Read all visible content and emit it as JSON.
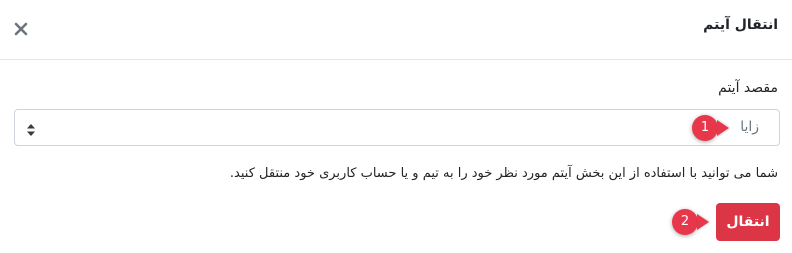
{
  "dialog": {
    "title": "انتقال آیتم",
    "close_icon": "close-icon"
  },
  "form": {
    "destination_label": "مقصد آیتم",
    "destination_value": "زایا",
    "help_text": "شما می توانید با استفاده از این بخش آیتم مورد نظر خود را به تیم و یا حساب کاربری خود منتقل کنید."
  },
  "actions": {
    "submit_label": "انتقال"
  },
  "annotations": {
    "step1": "1",
    "step2": "2"
  },
  "colors": {
    "primary_danger": "#dc3545",
    "annotation": "#e8364a",
    "border": "#ced4da"
  }
}
